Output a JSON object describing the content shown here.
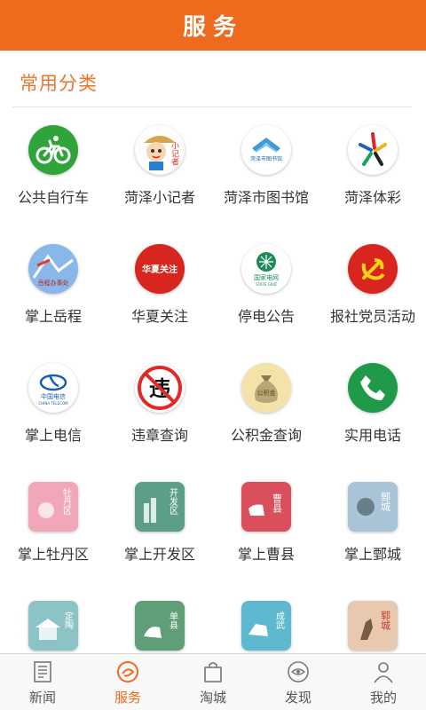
{
  "header": {
    "title": "服务"
  },
  "section": {
    "title": "常用分类"
  },
  "colors": {
    "accent": "#ee6a1c"
  },
  "items": [
    {
      "label": "公共自行车",
      "icon": "bicycle-icon"
    },
    {
      "label": "菏泽小记者",
      "icon": "reporter-mascot-icon",
      "text": "小记者"
    },
    {
      "label": "菏泽市图书馆",
      "icon": "library-icon",
      "text": "菏泽市图书馆"
    },
    {
      "label": "菏泽体彩",
      "icon": "lottery-star-icon"
    },
    {
      "label": "掌上岳程",
      "icon": "yuecheng-icon",
      "text": "岳程办事处"
    },
    {
      "label": "华夏关注",
      "icon": "huaxia-icon",
      "text": "华夏关注"
    },
    {
      "label": "停电公告",
      "icon": "state-grid-icon",
      "text": "国家电网",
      "subtext": "STATE GRID"
    },
    {
      "label": "报社党员活动",
      "icon": "party-emblem-icon"
    },
    {
      "label": "掌上电信",
      "icon": "china-telecom-icon",
      "text": "中国电信",
      "subtext": "CHINA TELECOM"
    },
    {
      "label": "违章查询",
      "icon": "violation-icon",
      "text": "违"
    },
    {
      "label": "公积金查询",
      "icon": "fund-bag-icon",
      "text": "公积金"
    },
    {
      "label": "实用电话",
      "icon": "phone-icon"
    },
    {
      "label": "掌上牡丹区",
      "icon": "mudan-icon",
      "text": "牡丹区"
    },
    {
      "label": "掌上开发区",
      "icon": "kaifa-icon",
      "text": "开发区"
    },
    {
      "label": "掌上曹县",
      "icon": "caoxian-icon",
      "text": "曹县"
    },
    {
      "label": "掌上鄄城",
      "icon": "juancheng-icon",
      "text": "鄄城"
    },
    {
      "label": "",
      "icon": "dingtao-icon",
      "text": "定陶"
    },
    {
      "label": "",
      "icon": "shanxian-icon",
      "text": "单县"
    },
    {
      "label": "",
      "icon": "chengwu-icon",
      "text": "成武"
    },
    {
      "label": "",
      "icon": "yuncheng-icon",
      "text": "郓城"
    }
  ],
  "tabs": [
    {
      "label": "新闻",
      "icon": "newspaper-icon",
      "active": false
    },
    {
      "label": "服务",
      "icon": "service-icon",
      "active": true
    },
    {
      "label": "淘城",
      "icon": "shopping-bag-icon",
      "active": false
    },
    {
      "label": "发现",
      "icon": "discover-icon",
      "active": false
    },
    {
      "label": "我的",
      "icon": "user-icon",
      "active": false
    }
  ]
}
